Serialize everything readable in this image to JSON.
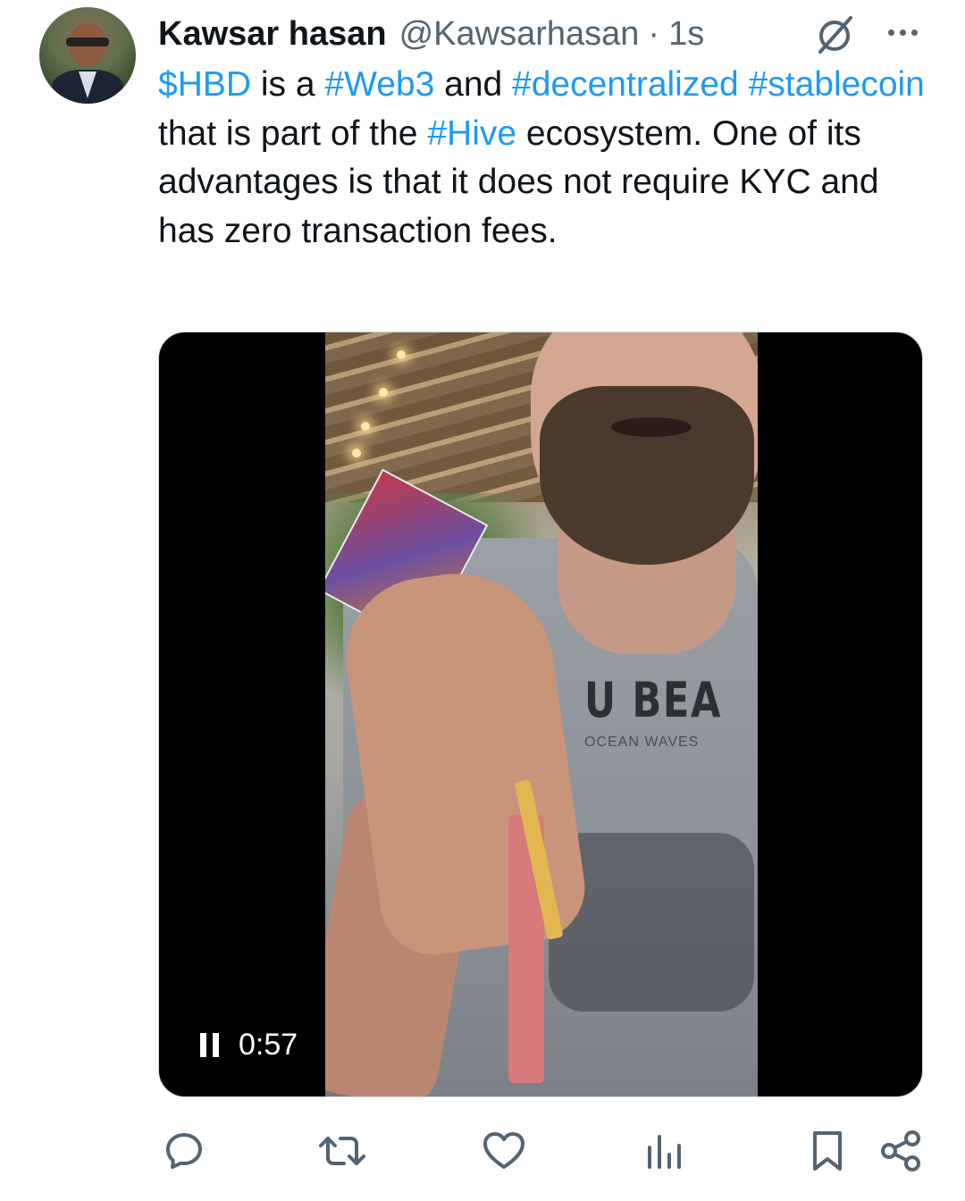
{
  "tweet": {
    "author_name": "Kawsar hasan",
    "author_handle": "@Kawsarhasan",
    "separator": "·",
    "timestamp": "1s",
    "text_segments": [
      {
        "text": "$HBD",
        "type": "cashtag"
      },
      {
        "text": " is a ",
        "type": "plain"
      },
      {
        "text": "#Web3",
        "type": "hashtag"
      },
      {
        "text": " and ",
        "type": "plain"
      },
      {
        "text": "#decentralized",
        "type": "hashtag"
      },
      {
        "text": " ",
        "type": "plain"
      },
      {
        "text": "#stablecoin",
        "type": "hashtag"
      },
      {
        "text": " that is part of the ",
        "type": "plain"
      },
      {
        "text": "#Hive",
        "type": "hashtag"
      },
      {
        "text": " ecosystem. One of its advantages is that it does not require KYC and has zero transaction fees.",
        "type": "plain"
      }
    ]
  },
  "media": {
    "video_duration": "0:57",
    "shirt_print": "U BEA",
    "shirt_subprint": "OCEAN WAVES"
  },
  "actions": {
    "icons": [
      "reply-icon",
      "retweet-icon",
      "like-icon",
      "views-icon",
      "bookmark-icon",
      "share-icon"
    ]
  },
  "colors": {
    "link": "#1d9bf0",
    "secondary_text": "#536471",
    "primary_text": "#0f1419"
  }
}
